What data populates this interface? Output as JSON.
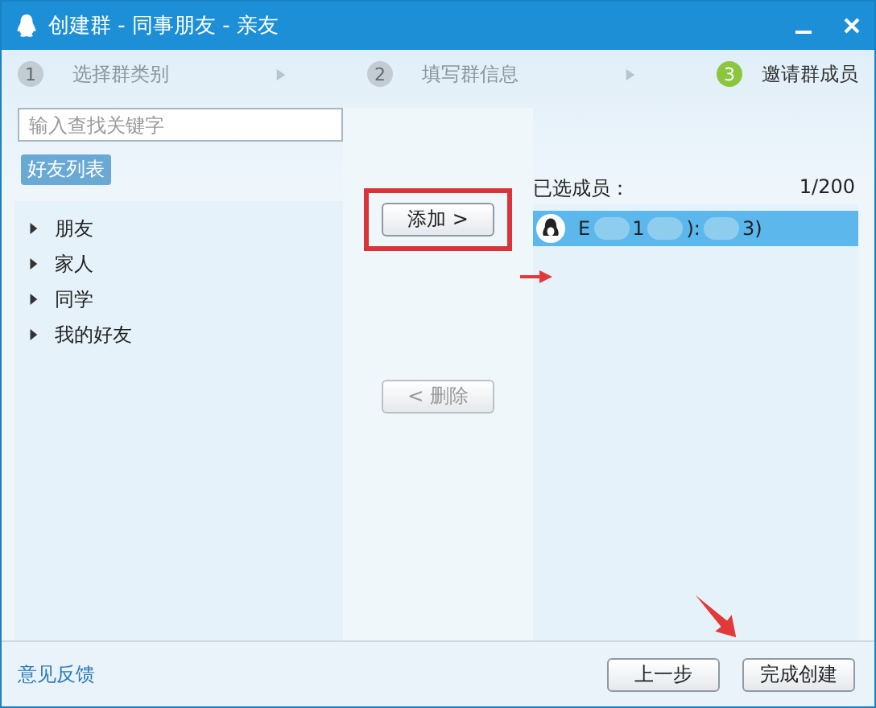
{
  "window": {
    "title": "创建群 - 同事朋友 - 亲友"
  },
  "steps": [
    {
      "number": "1",
      "label": "选择群类别",
      "selected": false
    },
    {
      "number": "2",
      "label": "填写群信息",
      "selected": false
    },
    {
      "number": "3",
      "label": "邀请群成员",
      "selected": true
    }
  ],
  "search": {
    "placeholder": "输入查找关键字"
  },
  "friend_list": {
    "tab": "好友列表",
    "groups": [
      {
        "label": "朋友",
        "expanded": false
      },
      {
        "label": "家人",
        "expanded": false
      },
      {
        "label": "同学",
        "expanded": false
      },
      {
        "label": "我的好友",
        "expanded": false
      }
    ]
  },
  "add_button": "添加 >",
  "remove_button": {
    "label": "< 删除",
    "disabled": true
  },
  "selected_members": {
    "title": "已选成员：",
    "count": "1/200",
    "members": [
      {
        "name_parts": [
          "E",
          "1",
          "):",
          "3)"
        ],
        "selected": true
      }
    ]
  },
  "footer": {
    "feedback_link": "意见反馈",
    "buttons": [
      "上一步",
      "完成创建"
    ]
  }
}
